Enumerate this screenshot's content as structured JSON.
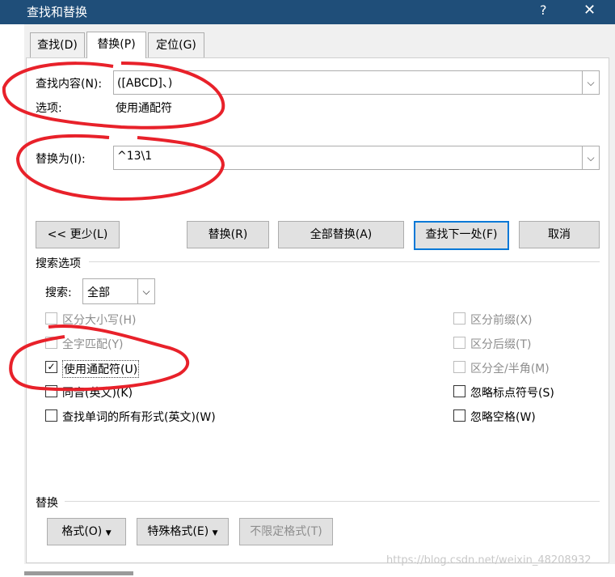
{
  "window": {
    "title": "查找和替换",
    "help": "?",
    "close": "✕"
  },
  "tabs": [
    {
      "label": "查找(D)"
    },
    {
      "label": "替换(P)"
    },
    {
      "label": "定位(G)"
    }
  ],
  "find": {
    "label": "查找内容(N):",
    "value": "([ABCD]、)",
    "options_label": "选项:",
    "options_value": "使用通配符"
  },
  "replace": {
    "label": "替换为(I):",
    "value": "^13\\1"
  },
  "buttons": {
    "less": "<< 更少(L)",
    "replace": "替换(R)",
    "replace_all": "全部替换(A)",
    "find_next": "查找下一处(F)",
    "cancel": "取消"
  },
  "search_options": {
    "section": "搜索选项",
    "search_label": "搜索:",
    "search_value": "全部",
    "left": [
      {
        "label": "区分大小写(H)",
        "checked": false,
        "disabled": true
      },
      {
        "label": "全字匹配(Y)",
        "checked": false,
        "disabled": true
      },
      {
        "label": "使用通配符(U)",
        "checked": true,
        "disabled": false
      },
      {
        "label": "同音(英文)(K)",
        "checked": false,
        "disabled": false
      },
      {
        "label": "查找单词的所有形式(英文)(W)",
        "checked": false,
        "disabled": false
      }
    ],
    "right": [
      {
        "label": "区分前缀(X)",
        "checked": false,
        "disabled": true
      },
      {
        "label": "区分后缀(T)",
        "checked": false,
        "disabled": true
      },
      {
        "label": "区分全/半角(M)",
        "checked": false,
        "disabled": true
      },
      {
        "label": "忽略标点符号(S)",
        "checked": false,
        "disabled": false
      },
      {
        "label": "忽略空格(W)",
        "checked": false,
        "disabled": false
      }
    ]
  },
  "replace_section": {
    "label": "替换",
    "format": "格式(O)",
    "special": "特殊格式(E)",
    "no_format": "不限定格式(T)"
  },
  "watermark": "https://blog.csdn.net/weixin_48208932",
  "colors": {
    "titlebar": "#1f4e79",
    "annotation": "#e8212a",
    "focus": "#0078d7"
  }
}
